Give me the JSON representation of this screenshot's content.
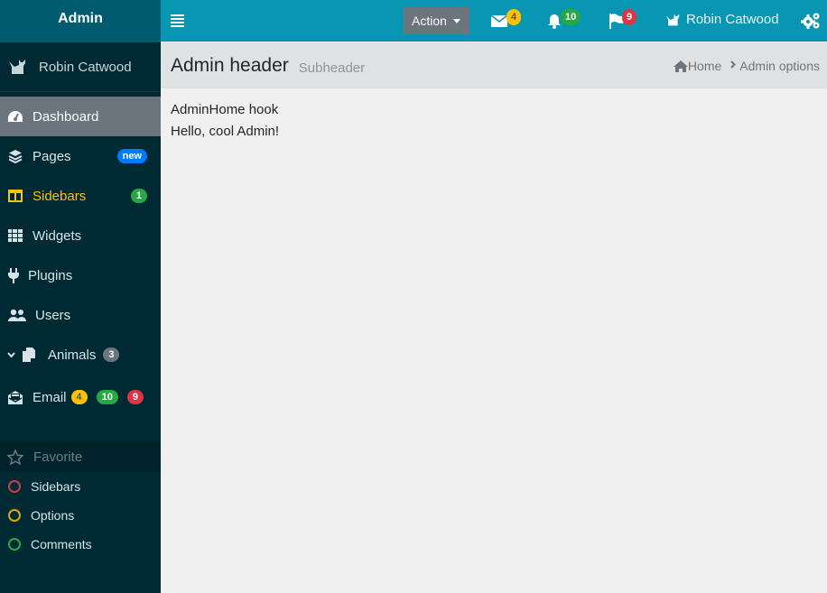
{
  "brand": {
    "title": "Admin"
  },
  "user": {
    "name": "Robin Catwood",
    "icon": "cat-icon"
  },
  "sidebar": {
    "items": [
      {
        "label": "Dashboard",
        "icon": "tachometer-icon",
        "state": "active"
      },
      {
        "label": "Pages",
        "icon": "layers-icon",
        "badge": "new",
        "badge_color": "#007bff"
      },
      {
        "label": "Sidebars",
        "icon": "columns-icon",
        "state": "warning",
        "badge": "1",
        "badge_color": "#28a745"
      },
      {
        "label": "Widgets",
        "icon": "grid-icon"
      },
      {
        "label": "Plugins",
        "icon": "plug-icon"
      },
      {
        "label": "Users",
        "icon": "users-icon"
      },
      {
        "label": "Animals",
        "icon": "copy-icon",
        "expander": "chevron-down-icon",
        "badge": "3",
        "badge_color": "#6c757d"
      },
      {
        "label": "Email",
        "icon": "envelope-open-icon",
        "badges": [
          {
            "text": "4",
            "color": "#ffc107"
          },
          {
            "text": "10",
            "color": "#28a745"
          },
          {
            "text": "9",
            "color": "#dc3545"
          }
        ]
      }
    ],
    "favorite": {
      "header": "Favorite",
      "icon": "star-icon",
      "items": [
        {
          "label": "Sidebars",
          "color": "#dc3545"
        },
        {
          "label": "Options",
          "color": "#ffc107"
        },
        {
          "label": "Comments",
          "color": "#28a745"
        }
      ]
    }
  },
  "topbar": {
    "menu_icon": "hamburger-icon",
    "action_label": "Action",
    "messages": {
      "icon": "envelope-icon",
      "count": "4",
      "color": "#ffc107"
    },
    "notifications": {
      "icon": "bell-icon",
      "count": "10",
      "color": "#28a745"
    },
    "flags": {
      "icon": "flag-icon",
      "count": "9",
      "color": "#dc3545"
    },
    "user_name": "Robin Catwood",
    "settings_icon": "cogs-icon"
  },
  "header": {
    "title": "Admin header",
    "subtitle": "Subheader",
    "breadcrumb": [
      "Home",
      "Admin options"
    ]
  },
  "content": {
    "lines": [
      "AdminHome hook",
      "Hello, cool Admin!"
    ]
  }
}
